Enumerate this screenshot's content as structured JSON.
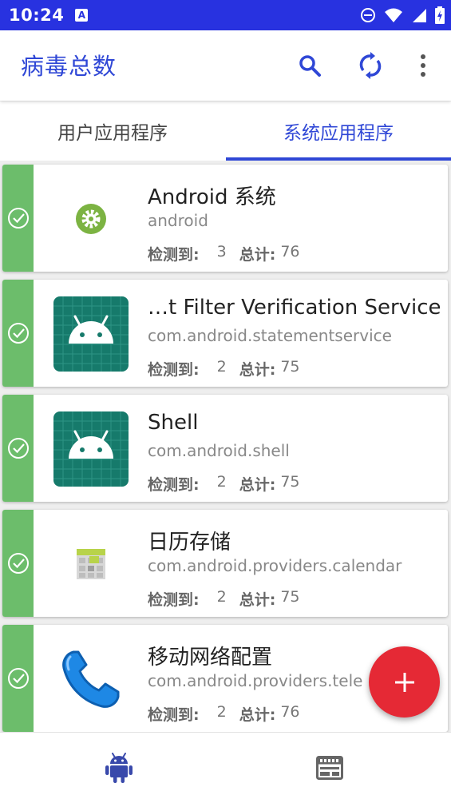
{
  "status_bar": {
    "time": "10:24",
    "notification_badge": "A"
  },
  "app_bar": {
    "title": "病毒总数",
    "actions": [
      "search-icon",
      "sync-icon",
      "more-vert-icon"
    ]
  },
  "tabs": [
    {
      "label": "用户应用程序",
      "selected": false
    },
    {
      "label": "系统应用程序",
      "selected": true
    }
  ],
  "stats_labels": {
    "detected": "检测到:",
    "total": "总计:"
  },
  "apps": [
    {
      "title": "Android 系统",
      "package": "android",
      "detected": "3",
      "total": "76",
      "icon": "settings-gear-icon"
    },
    {
      "title": "…t Filter Verification Service",
      "package": "com.android.statementservice",
      "detected": "2",
      "total": "75",
      "icon": "android-robot-icon"
    },
    {
      "title": "Shell",
      "package": "com.android.shell",
      "detected": "2",
      "total": "75",
      "icon": "android-robot-icon"
    },
    {
      "title": "日历存储",
      "package": "com.android.providers.calendar",
      "detected": "2",
      "total": "75",
      "icon": "calendar-icon"
    },
    {
      "title": "移动网络配置",
      "package": "com.android.providers.tele",
      "detected": "2",
      "total": "76",
      "icon": "phone-icon"
    }
  ],
  "bottom_nav": [
    {
      "icon": "android-icon",
      "active": true
    },
    {
      "icon": "web-panel-icon",
      "active": false
    }
  ],
  "colors": {
    "primary": "#2f47d6",
    "status_bar": "#2832e0",
    "strip": "#6cbd6b",
    "fab": "#e52935"
  }
}
